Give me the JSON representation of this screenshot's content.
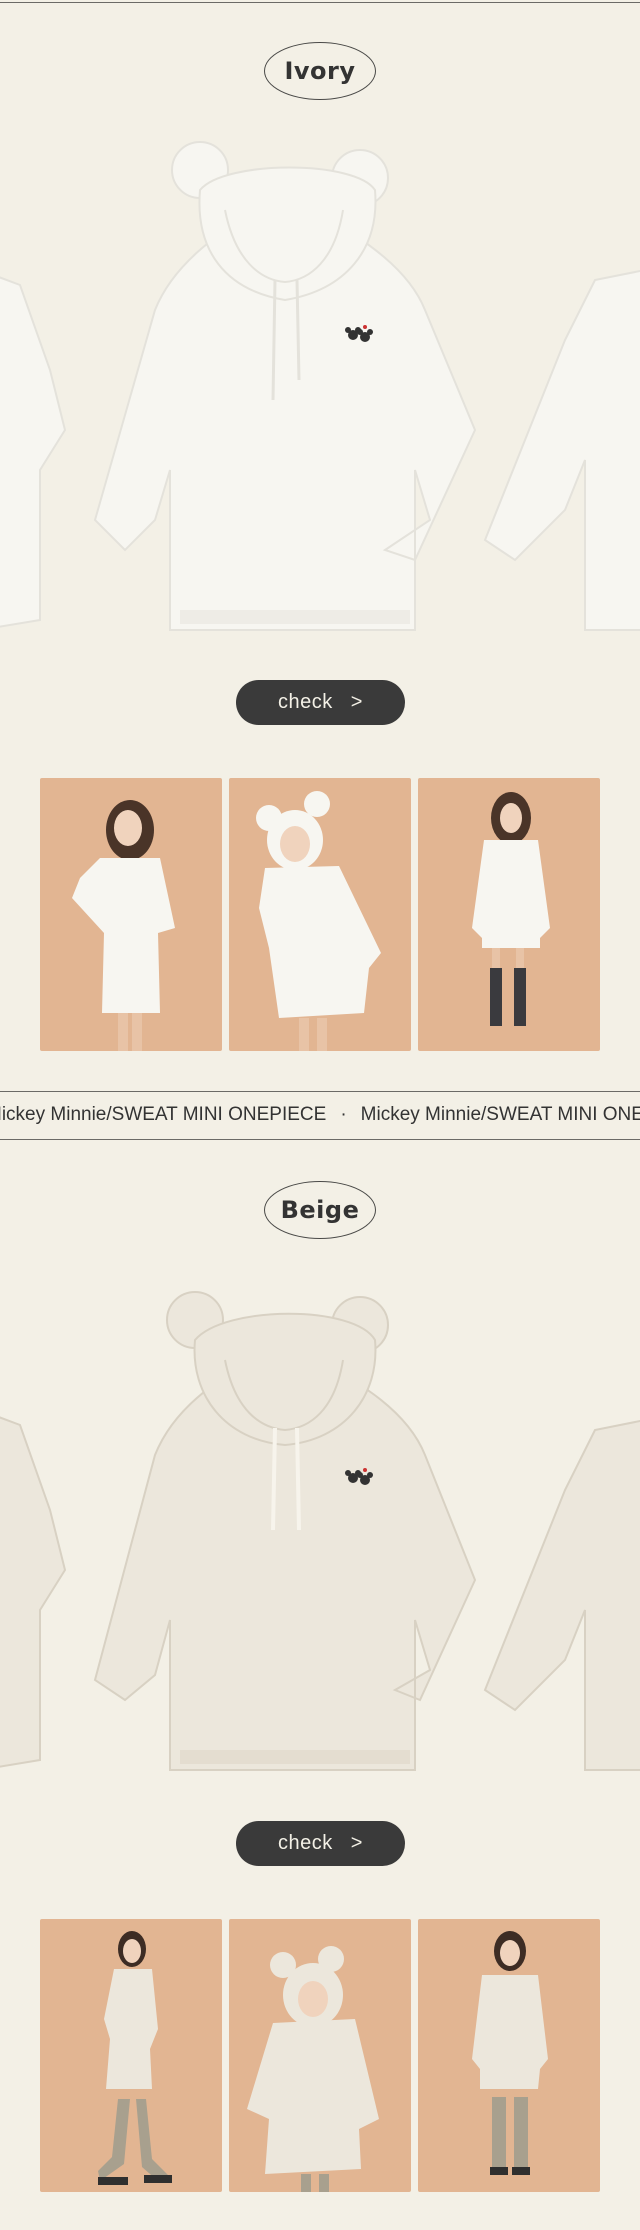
{
  "sections": [
    {
      "color_label": "Ivory",
      "check_label": "check",
      "check_arrow": ">",
      "hoodie_color": "#f7f6f1",
      "hoodie_shadow": "#e4e2db",
      "photo_bg": "#e2b592"
    },
    {
      "color_label": "Beige",
      "check_label": "check",
      "check_arrow": ">",
      "hoodie_color": "#ece7dc",
      "hoodie_shadow": "#d8d1c3",
      "photo_bg": "#e2b592"
    }
  ],
  "marquee": {
    "text": "Mickey Minnie/SWEAT MINI ONEPIECE",
    "separator": "·"
  },
  "colors": {
    "page_bg": "#f3f0e6",
    "button_bg": "#3a3a3a",
    "text": "#333333"
  }
}
